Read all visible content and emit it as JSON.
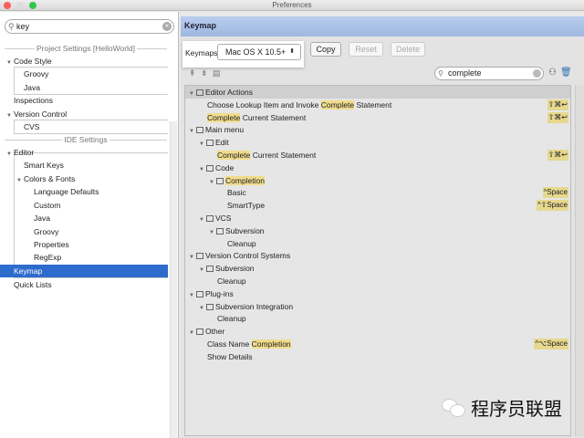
{
  "window": {
    "title": "Preferences",
    "controls": {
      "close": "#fc605c",
      "minimize": "#fdbc40",
      "maximize": "#34c84a"
    }
  },
  "sidebar": {
    "search": {
      "value": "key"
    },
    "headers": [
      "Project Settings [HelloWorld]",
      "IDE Settings"
    ],
    "items": [
      {
        "label": "Code Style",
        "level": 0,
        "expanded": true
      },
      {
        "label": "Groovy",
        "level": 1
      },
      {
        "label": "Java",
        "level": 1
      },
      {
        "label": "Inspections",
        "level": 0
      },
      {
        "label": "Version Control",
        "level": 0,
        "expanded": true
      },
      {
        "label": "CVS",
        "level": 1
      },
      {
        "label": "Editor",
        "level": 0,
        "expanded": true
      },
      {
        "label": "Smart Keys",
        "level": 1
      },
      {
        "label": "Colors & Fonts",
        "level": 1,
        "expanded": true
      },
      {
        "label": "Language Defaults",
        "level": 2
      },
      {
        "label": "Custom",
        "level": 2
      },
      {
        "label": "Java",
        "level": 2
      },
      {
        "label": "Groovy",
        "level": 2
      },
      {
        "label": "Properties",
        "level": 2
      },
      {
        "label": "RegExp",
        "level": 2
      },
      {
        "label": "Keymap",
        "level": 0,
        "selected": true
      },
      {
        "label": "Quick Lists",
        "level": 0
      }
    ]
  },
  "keymap": {
    "title": "Keymap",
    "keymaps_label": "Keymaps:",
    "selected_keymap": "Mac OS X 10.5+",
    "buttons": {
      "copy": "Copy",
      "reset": "Reset",
      "delete": "Delete"
    },
    "filter": {
      "value": "complete"
    },
    "tree": [
      {
        "level": 0,
        "folder": true,
        "parts": [
          [
            "Editor Actions",
            false
          ]
        ]
      },
      {
        "level": 2,
        "parts": [
          [
            "Choose Lookup Item and Invoke ",
            false
          ],
          [
            "Complete",
            true
          ],
          [
            " Statement",
            false
          ]
        ],
        "shortcut": "⇧⌘↩"
      },
      {
        "level": 2,
        "parts": [
          [
            "Complete",
            true
          ],
          [
            " Current Statement",
            false
          ]
        ],
        "shortcut": "⇧⌘↩"
      },
      {
        "level": 0,
        "folder": true,
        "parts": [
          [
            "Main menu",
            false
          ]
        ]
      },
      {
        "level": 1,
        "folder": true,
        "parts": [
          [
            "Edit",
            false
          ]
        ]
      },
      {
        "level": 3,
        "parts": [
          [
            "Complete",
            true
          ],
          [
            " Current Statement",
            false
          ]
        ],
        "shortcut": "⇧⌘↩"
      },
      {
        "level": 1,
        "folder": true,
        "parts": [
          [
            "Code",
            false
          ]
        ]
      },
      {
        "level": 2,
        "folder": true,
        "parts": [
          [
            "Completion",
            true
          ]
        ]
      },
      {
        "level": 4,
        "parts": [
          [
            "Basic",
            false
          ]
        ],
        "shortcut": "^Space"
      },
      {
        "level": 4,
        "parts": [
          [
            "SmartType",
            false
          ]
        ],
        "shortcut": "^⇧Space"
      },
      {
        "level": 1,
        "folder": true,
        "parts": [
          [
            "VCS",
            false
          ]
        ]
      },
      {
        "level": 2,
        "folder": true,
        "parts": [
          [
            "Subversion",
            false
          ]
        ]
      },
      {
        "level": 4,
        "parts": [
          [
            "Cleanup",
            false
          ]
        ]
      },
      {
        "level": 0,
        "folder": true,
        "parts": [
          [
            "Version Control Systems",
            false
          ]
        ]
      },
      {
        "level": 1,
        "folder": true,
        "parts": [
          [
            "Subversion",
            false
          ]
        ]
      },
      {
        "level": 3,
        "parts": [
          [
            "Cleanup",
            false
          ]
        ]
      },
      {
        "level": 0,
        "folder": true,
        "parts": [
          [
            "Plug-ins",
            false
          ]
        ]
      },
      {
        "level": 1,
        "folder": true,
        "parts": [
          [
            "Subversion Integration",
            false
          ]
        ]
      },
      {
        "level": 3,
        "parts": [
          [
            "Cleanup",
            false
          ]
        ]
      },
      {
        "level": 0,
        "folder": true,
        "parts": [
          [
            "Other",
            false
          ]
        ]
      },
      {
        "level": 2,
        "parts": [
          [
            "Class Name ",
            false
          ],
          [
            "Completion",
            true
          ]
        ],
        "shortcut": "^⌥Space"
      },
      {
        "level": 2,
        "parts": [
          [
            "Show Details",
            false
          ]
        ]
      }
    ]
  },
  "watermark": "程序员联盟"
}
